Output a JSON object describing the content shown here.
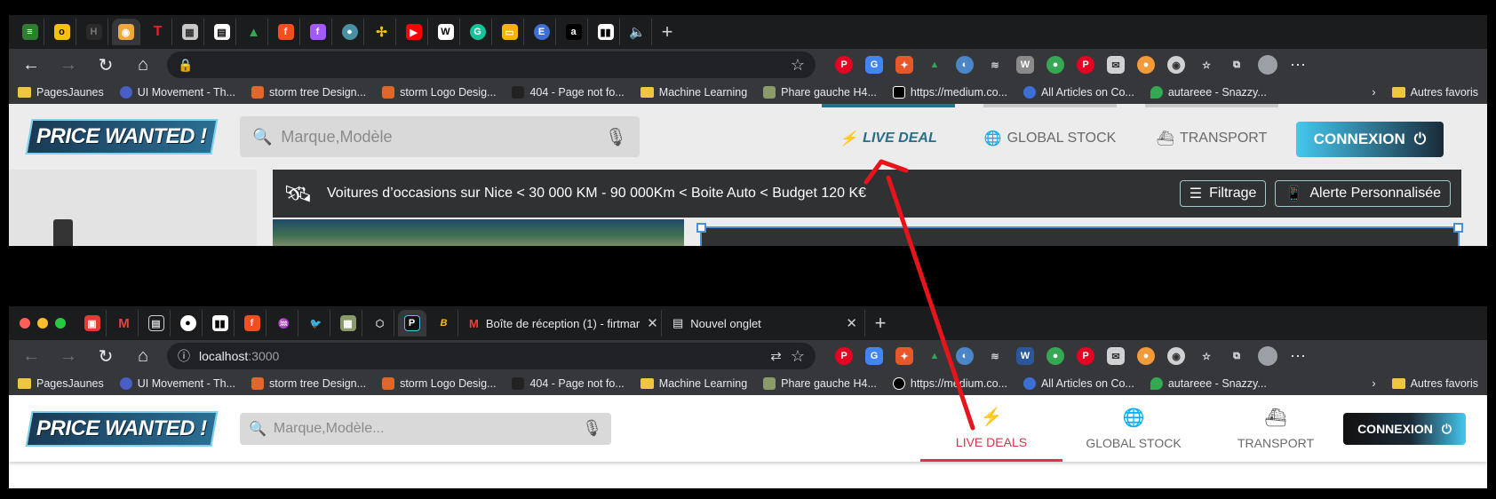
{
  "shot1": {
    "toolbar": {
      "star_icon": "star-icon"
    },
    "bookmarks": [
      "PagesJaunes",
      "UI Movement - Th...",
      "storm tree Design...",
      "storm Logo Desig...",
      "404 - Page not fo...",
      "Machine Learning",
      "Phare gauche H4...",
      "https://medium.co...",
      "All Articles on Co...",
      "autareee - Snazzy..."
    ],
    "bookmarks_more": "›",
    "bookmarks_other": "Autres favoris",
    "site": {
      "logo": "PRICE WANTED !",
      "search_placeholder": "Marque,Modèle",
      "nav": [
        "LIVE DEAL",
        "GLOBAL STOCK",
        "TRANSPORT"
      ],
      "connexion": "CONNEXION",
      "banner_text": "Voitures d’occasions sur Nice < 30 000 KM - 90 000Km < Boite Auto < Budget 120 K€",
      "filter_label": "Filtrage",
      "alert_label": "Alerte Personnalisée"
    }
  },
  "shot2": {
    "tabs": [
      {
        "title": "Boîte de réception (1) - firtmar"
      },
      {
        "title": "Nouvel onglet"
      }
    ],
    "url_host": "localhost",
    "url_port": ":3000",
    "bookmarks": [
      "PagesJaunes",
      "UI Movement - Th...",
      "storm tree Design...",
      "storm Logo Desig...",
      "404 - Page not fo...",
      "Machine Learning",
      "Phare gauche H4...",
      "https://medium.co...",
      "All Articles on Co...",
      "autareee - Snazzy..."
    ],
    "bookmarks_more": "›",
    "bookmarks_other": "Autres favoris",
    "site": {
      "logo": "PRICE WANTED !",
      "search_placeholder": "Marque,Modèle...",
      "nav": [
        "LIVE DEALS",
        "GLOBAL STOCK",
        "TRANSPORT"
      ],
      "connexion": "CONNEXION"
    }
  },
  "colors": {
    "annotation_arrow": "#e8141b",
    "active_tab_new": "#d9344a",
    "active_tab_old": "#2a6f8a"
  }
}
